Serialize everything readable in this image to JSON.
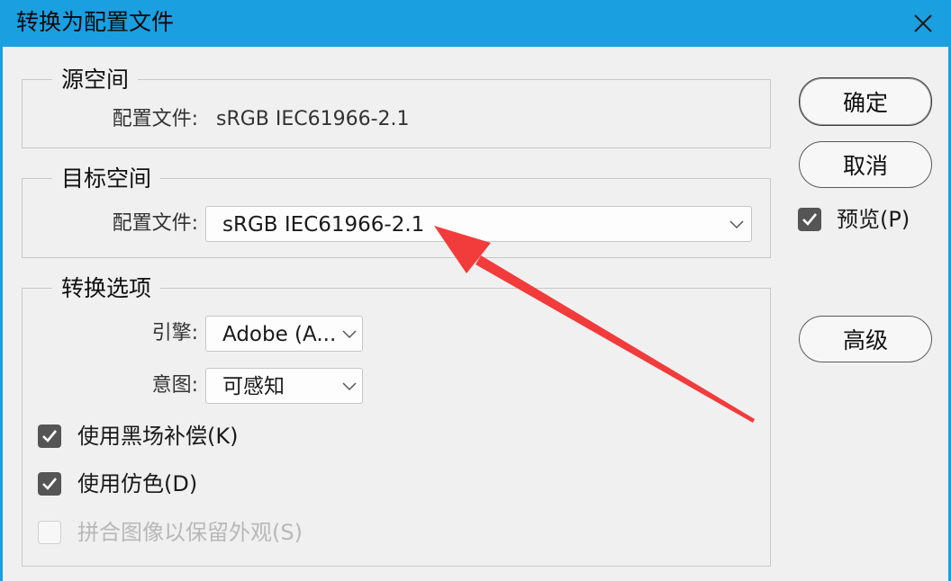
{
  "window": {
    "title": "转换为配置文件",
    "close_icon": "close-icon"
  },
  "source_space": {
    "title": "源空间",
    "profile_label": "配置文件:",
    "profile_value": "sRGB IEC61966-2.1"
  },
  "destination_space": {
    "title": "目标空间",
    "profile_label": "配置文件:",
    "profile_value": "sRGB IEC61966-2.1"
  },
  "conversion_options": {
    "title": "转换选项",
    "engine_label": "引擎:",
    "engine_value": "Adobe (A...",
    "intent_label": "意图:",
    "intent_value": "可感知",
    "black_point": {
      "label": "使用黑场补偿(K)",
      "checked": true
    },
    "dither": {
      "label": "使用仿色(D)",
      "checked": true
    },
    "flatten": {
      "label": "拼合图像以保留外观(S)",
      "checked": false,
      "enabled": false
    }
  },
  "buttons": {
    "ok": "确定",
    "cancel": "取消",
    "advanced": "高级"
  },
  "preview": {
    "label": "预览(P)",
    "checked": true
  },
  "colors": {
    "title_bar": "#1a9fe0",
    "dialog_bg": "#f0f0f0",
    "checkbox_checked": "#555555",
    "annotation_arrow": "#f23b3b"
  }
}
